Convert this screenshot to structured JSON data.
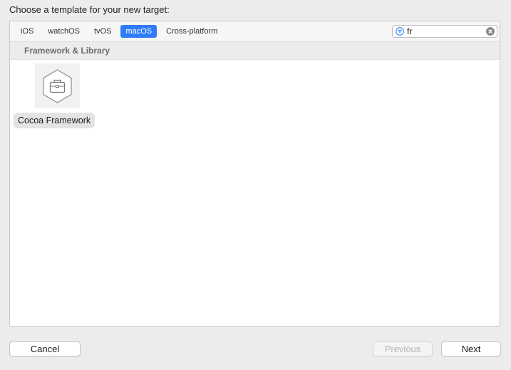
{
  "dialog": {
    "heading": "Choose a template for your new target:"
  },
  "tabs": [
    {
      "label": "iOS",
      "selected": false
    },
    {
      "label": "watchOS",
      "selected": false
    },
    {
      "label": "tvOS",
      "selected": false
    },
    {
      "label": "macOS",
      "selected": true
    },
    {
      "label": "Cross-platform",
      "selected": false
    }
  ],
  "search": {
    "value": "fr",
    "filter_icon": "filter-icon",
    "clear_icon": "clear-icon"
  },
  "section": {
    "title": "Framework & Library"
  },
  "templates": [
    {
      "label": "Cocoa Framework",
      "icon": "framework-toolbox-icon",
      "selected": true
    }
  ],
  "buttons": {
    "cancel": "Cancel",
    "previous": "Previous",
    "next": "Next"
  },
  "colors": {
    "accent": "#2f7cf6",
    "disabled_text": "#b4b4b4"
  }
}
